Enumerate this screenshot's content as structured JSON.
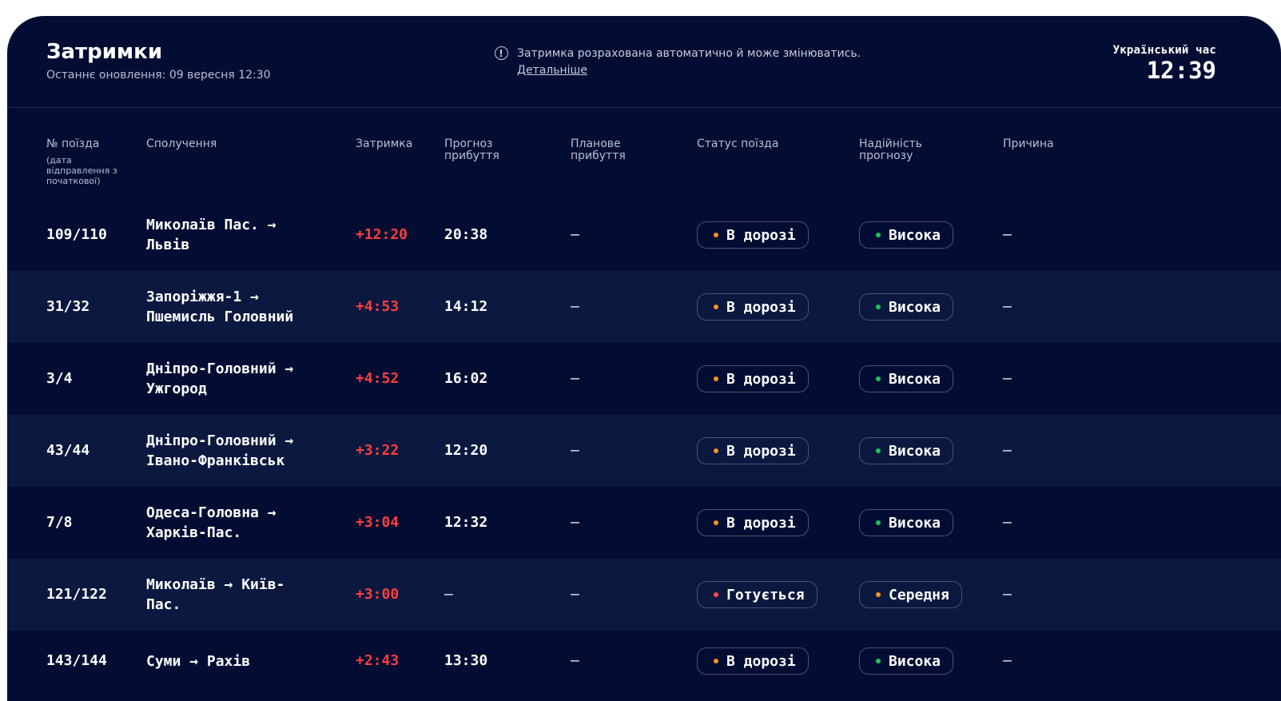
{
  "header": {
    "title": "Затримки",
    "updated": "Останнє оновлення: 09 вересня 12:30",
    "notice": "Затримка розрахована автоматично й може змінюватись.",
    "notice_link": "Детальніше",
    "clock_label": "Український час",
    "clock_time": "12:39"
  },
  "columns": {
    "train": "№ поїзда",
    "train_sub": "(дата відправлення з початкової)",
    "route": "Сполучення",
    "delay": "Затримка",
    "forecast": "Прогноз прибуття",
    "planned": "Планове прибуття",
    "status": "Статус поїзда",
    "reliability": "Надійність прогнозу",
    "reason": "Причина"
  },
  "colors": {
    "background": "#030d33",
    "row_alt": "#0b1840",
    "delay": "#ff3d3d",
    "dot_orange": "#f5922a",
    "dot_red": "#ff4a4a",
    "dot_green": "#21c25e"
  },
  "rows": [
    {
      "train": "109/110",
      "route": "Миколаїв Пас. → Львів",
      "delay": "+12:20",
      "forecast": "20:38",
      "planned": "—",
      "status": "В дорозі",
      "status_color": "#f5922a",
      "reliability": "Висока",
      "reliability_color": "#21c25e",
      "reason": "—"
    },
    {
      "train": "31/32",
      "route": "Запоріжжя-1 → Пшемисль Головний",
      "delay": "+4:53",
      "forecast": "14:12",
      "planned": "—",
      "status": "В дорозі",
      "status_color": "#f5922a",
      "reliability": "Висока",
      "reliability_color": "#21c25e",
      "reason": "—"
    },
    {
      "train": "3/4",
      "route": "Дніпро-Головний → Ужгород",
      "delay": "+4:52",
      "forecast": "16:02",
      "planned": "—",
      "status": "В дорозі",
      "status_color": "#f5922a",
      "reliability": "Висока",
      "reliability_color": "#21c25e",
      "reason": "—"
    },
    {
      "train": "43/44",
      "route": "Дніпро-Головний → Івано-Франківськ",
      "delay": "+3:22",
      "forecast": "12:20",
      "planned": "—",
      "status": "В дорозі",
      "status_color": "#f5922a",
      "reliability": "Висока",
      "reliability_color": "#21c25e",
      "reason": "—"
    },
    {
      "train": "7/8",
      "route": "Одеса-Головна → Харків-Пас.",
      "delay": "+3:04",
      "forecast": "12:32",
      "planned": "—",
      "status": "В дорозі",
      "status_color": "#f5922a",
      "reliability": "Висока",
      "reliability_color": "#21c25e",
      "reason": "—"
    },
    {
      "train": "121/122",
      "route": "Миколаїв →  Київ-Пас.",
      "delay": "+3:00",
      "forecast": "—",
      "planned": "—",
      "status": "Готується",
      "status_color": "#ff4a4a",
      "reliability": "Середня",
      "reliability_color": "#f5922a",
      "reason": "—"
    },
    {
      "train": "143/144",
      "route": "Суми →  Рахів",
      "delay": "+2:43",
      "forecast": "13:30",
      "planned": "—",
      "status": "В дорозі",
      "status_color": "#f5922a",
      "reliability": "Висока",
      "reliability_color": "#21c25e",
      "reason": "—"
    }
  ]
}
